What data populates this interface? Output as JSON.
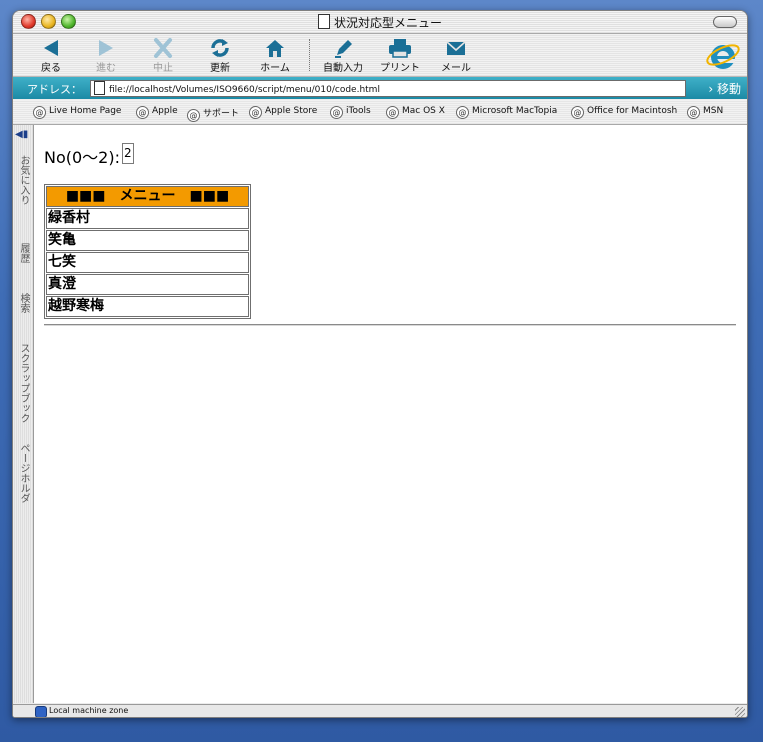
{
  "window": {
    "title": "状況対応型メニュー"
  },
  "toolbar": {
    "buttons": [
      {
        "label": "戻る",
        "icon": "back-arrow-icon",
        "enabled": true
      },
      {
        "label": "進む",
        "icon": "forward-arrow-icon",
        "enabled": false
      },
      {
        "label": "中止",
        "icon": "stop-x-icon",
        "enabled": false
      },
      {
        "label": "更新",
        "icon": "refresh-icon",
        "enabled": true
      },
      {
        "label": "ホーム",
        "icon": "home-icon",
        "enabled": true
      },
      {
        "label": "自動入力",
        "icon": "autofill-pen-icon",
        "enabled": true
      },
      {
        "label": "プリント",
        "icon": "printer-icon",
        "enabled": true
      },
      {
        "label": "メール",
        "icon": "mail-envelope-icon",
        "enabled": true
      }
    ]
  },
  "address": {
    "label": "アドレス：",
    "url": "file://localhost/Volumes/ISO9660/script/menu/010/code.html",
    "go_label": "移動"
  },
  "favorites": [
    "Live Home Page",
    "Apple",
    "サポート",
    "Apple Store",
    "iTools",
    "Mac OS X",
    "Microsoft MacTopia",
    "Office for Macintosh",
    "MSN"
  ],
  "sidebar": {
    "tabs": [
      "お気に入り",
      "履歴",
      "検索",
      "スクラップブック",
      "ページホルダ"
    ]
  },
  "page": {
    "no_label": "No(0〜2):",
    "no_value": "2",
    "menu_header": "■■■　メニュー　■■■",
    "menu_items": [
      "緑香村",
      "笑亀",
      "七笑",
      "真澄",
      "越野寒梅"
    ]
  },
  "status": {
    "zone": "Local machine zone"
  },
  "colors": {
    "menu_header_bg": "#f39a00",
    "address_bar": "#1c8aa5",
    "toolbar_icon": "#1b6f96"
  }
}
